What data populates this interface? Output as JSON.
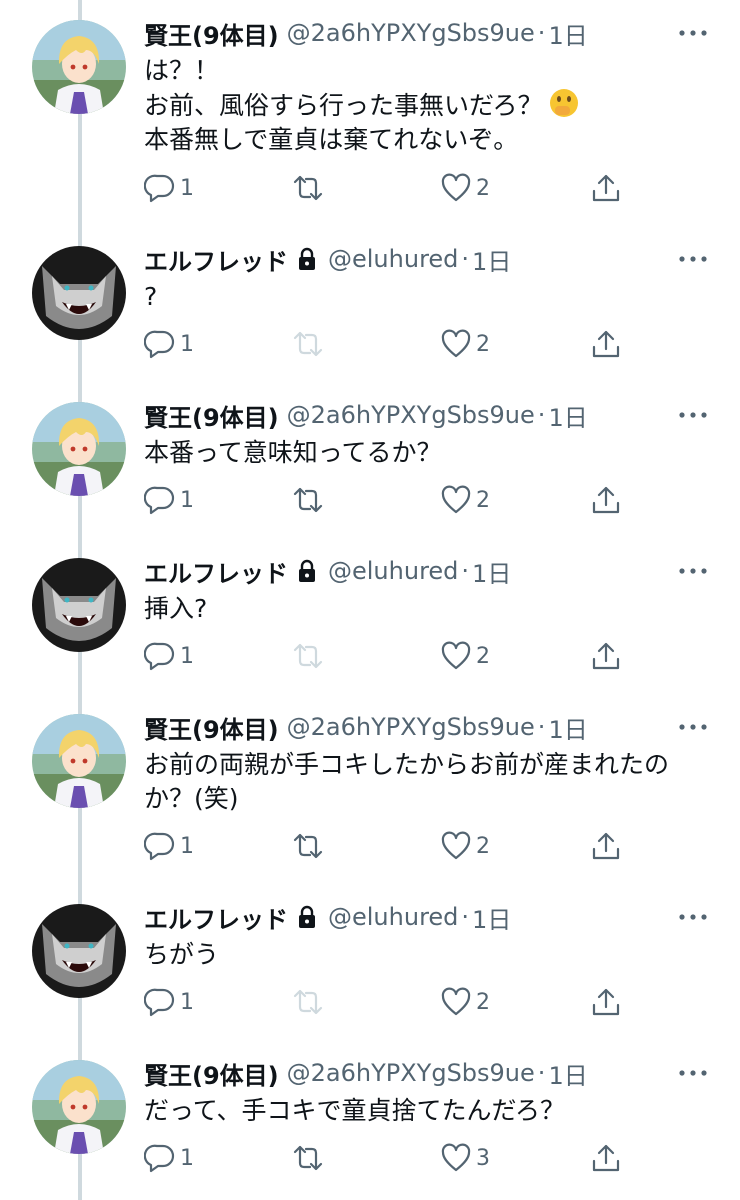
{
  "tweets": [
    {
      "author": "賢王(9体目)",
      "handle": "@2a6hYPXYgSbs9ue",
      "separator": "·",
      "time": "1日",
      "avatar": "blond-anime-boy",
      "protected": false,
      "lines": [
        "は？！",
        "お前、風俗すら行った事無いだろ？",
        "本番無しで童貞は棄てれないぞ。"
      ],
      "emoji": "face-with-hand-over-mouth",
      "replies": "1",
      "retweets": "",
      "likes": "2",
      "retweet_enabled": true
    },
    {
      "author": "エルフレッド",
      "handle": "@eluhured",
      "separator": "·",
      "time": "1日",
      "avatar": "grey-wolf",
      "protected": true,
      "lines": [
        "?"
      ],
      "replies": "1",
      "retweets": "",
      "likes": "2",
      "retweet_enabled": false
    },
    {
      "author": "賢王(9体目)",
      "handle": "@2a6hYPXYgSbs9ue",
      "separator": "·",
      "time": "1日",
      "avatar": "blond-anime-boy",
      "protected": false,
      "lines": [
        "本番って意味知ってるか？"
      ],
      "replies": "1",
      "retweets": "",
      "likes": "2",
      "retweet_enabled": true
    },
    {
      "author": "エルフレッド",
      "handle": "@eluhured",
      "separator": "·",
      "time": "1日",
      "avatar": "grey-wolf",
      "protected": true,
      "lines": [
        "挿入?"
      ],
      "replies": "1",
      "retweets": "",
      "likes": "2",
      "retweet_enabled": false
    },
    {
      "author": "賢王(9体目)",
      "handle": "@2a6hYPXYgSbs9ue",
      "separator": "·",
      "time": "1日",
      "avatar": "blond-anime-boy",
      "protected": false,
      "lines": [
        "お前の両親が手コキしたからお前が産まれたの",
        "か？(笑)"
      ],
      "replies": "1",
      "retweets": "",
      "likes": "2",
      "retweet_enabled": true
    },
    {
      "author": "エルフレッド",
      "handle": "@eluhured",
      "separator": "·",
      "time": "1日",
      "avatar": "grey-wolf",
      "protected": true,
      "lines": [
        "ちがう"
      ],
      "replies": "1",
      "retweets": "",
      "likes": "2",
      "retweet_enabled": false
    },
    {
      "author": "賢王(9体目)",
      "handle": "@2a6hYPXYgSbs9ue",
      "separator": "·",
      "time": "1日",
      "avatar": "blond-anime-boy",
      "protected": false,
      "lines": [
        "だって、手コキで童貞捨てたんだろ？"
      ],
      "replies": "1",
      "retweets": "",
      "likes": "3",
      "retweet_enabled": true
    }
  ],
  "colors": {
    "thread_line": "#cfd9de",
    "secondary_text": "#536471",
    "primary_text": "#0f1419"
  }
}
